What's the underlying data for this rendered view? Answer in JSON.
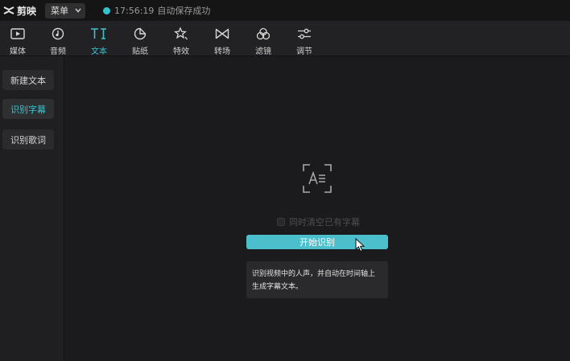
{
  "titlebar": {
    "app_name": "剪映",
    "menu_label": "菜单",
    "save_time": "17:56:19",
    "save_status": "自动保存成功"
  },
  "toolbar": {
    "items": [
      {
        "label": "媒体",
        "icon": "media-play-icon"
      },
      {
        "label": "音频",
        "icon": "audio-icon"
      },
      {
        "label": "文本",
        "icon": "text-ti-icon",
        "active": true
      },
      {
        "label": "贴纸",
        "icon": "sticker-icon"
      },
      {
        "label": "特效",
        "icon": "effects-star-icon"
      },
      {
        "label": "转场",
        "icon": "transition-icon"
      },
      {
        "label": "滤镜",
        "icon": "filter-circles-icon"
      },
      {
        "label": "调节",
        "icon": "adjust-sliders-icon"
      }
    ]
  },
  "sidebar": {
    "items": [
      {
        "label": "新建文本"
      },
      {
        "label": "识别字幕",
        "active": true
      },
      {
        "label": "识别歌词"
      }
    ]
  },
  "main": {
    "icon": "text-recognition-icon",
    "checkbox_label": "同时清空已有字幕",
    "start_button": "开始识别",
    "tip_line1": "识别视频中的人声，并自动在时间轴上",
    "tip_line2": "生成字幕文本。"
  },
  "colors": {
    "accent": "#3cc3d0",
    "button": "#4bbfcc",
    "background": "#1b1b1d"
  }
}
